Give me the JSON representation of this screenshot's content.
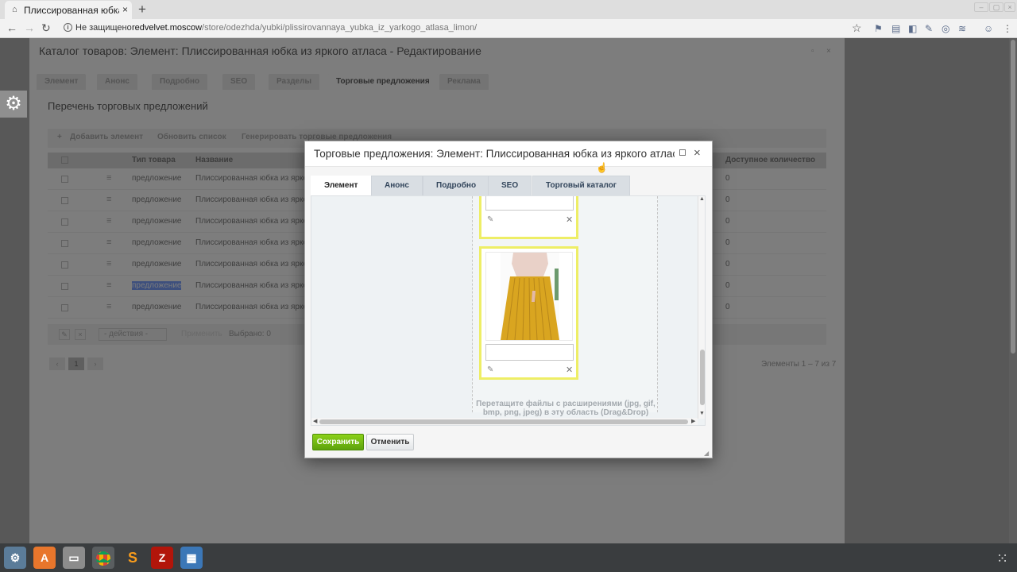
{
  "browser": {
    "tab_title": "Плиссированная юбка из",
    "tab_close": "×",
    "new_tab": "+",
    "security_label": "Не защищено",
    "url_host": "redvelvet.moscow",
    "url_path": "/store/odezhda/yubki/plissirovannaya_yubka_iz_yarkogo_atlasa_limon/",
    "star": "☆"
  },
  "page": {
    "title": "Каталог товаров: Элемент: Плиссированная юбка из яркого атласа - Редактирование",
    "tabs": [
      "Элемент",
      "Анонс",
      "Подробно",
      "SEO",
      "Разделы",
      "Торговые предложения",
      "Реклама"
    ],
    "active_tab": "Торговые предложения",
    "list_title": "Перечень торговых предложений",
    "grid_toolbar": {
      "add": "Добавить элемент",
      "refresh": "Обновить список",
      "generate": "Генерировать торговые предложения"
    },
    "grid_headers": {
      "type": "Тип товара",
      "name": "Название",
      "qty": "Доступное количество"
    },
    "rows": [
      {
        "type": "предложение",
        "name": "Плиссированная юбка из яркого атласа",
        "qty": "0"
      },
      {
        "type": "предложение",
        "name": "Плиссированная юбка из яркого атласа",
        "qty": "0"
      },
      {
        "type": "предложение",
        "name": "Плиссированная юбка из яркого атласа",
        "qty": "0"
      },
      {
        "type": "предложение",
        "name": "Плиссированная юбка из яркого атласа",
        "qty": "0"
      },
      {
        "type": "предложение",
        "name": "Плиссированная юбка из яркого атласа",
        "qty": "0"
      },
      {
        "type": "предложение",
        "name": "Плиссированная юбка из яркого атласа",
        "qty": "0"
      },
      {
        "type": "предложение",
        "name": "Плиссированная юбка из яркого атласа",
        "qty": "0"
      }
    ],
    "footer": {
      "actions_select": "- действия -",
      "apply": "Применить",
      "selected": "Выбрано: 0"
    },
    "pager": {
      "current": "1",
      "info": "Элементы 1 – 7 из 7"
    }
  },
  "modal": {
    "title": "Торговые предложения: Элемент: Плиссированная юбка из яркого атласа",
    "close": "×",
    "tabs": [
      "Элемент",
      "Анонс",
      "Подробно",
      "SEO",
      "Торговый каталог"
    ],
    "active_tab": "Элемент",
    "drop_text": "Перетащите файлы с расширениями (jpg, gif, bmp, png, jpeg) в эту область (Drag&Drop)",
    "save_label": "Сохранить",
    "cancel_label": "Отменить"
  },
  "colors": {
    "save_green": "#6cb511",
    "file_highlight": "#eeee66",
    "skirt_yellow": "#d9a520",
    "selection": "#3d4f7d"
  },
  "taskbar": [
    "settings-app",
    "software-center",
    "file-manager",
    "chrome",
    "sublime-text",
    "filezilla",
    "image-viewer"
  ]
}
